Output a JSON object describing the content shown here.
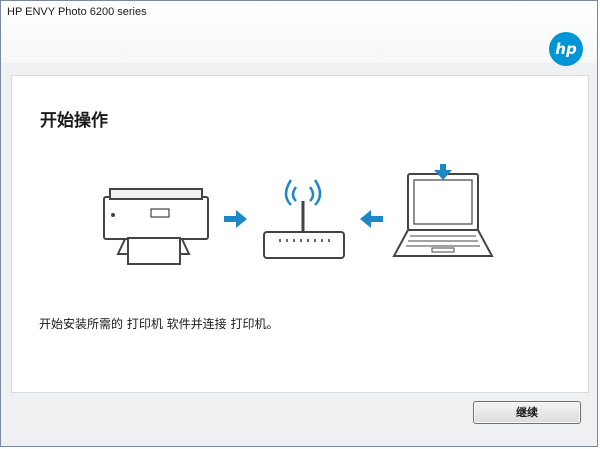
{
  "window": {
    "title": "HP ENVY Photo 6200 series"
  },
  "brand": {
    "logo_text": "hp",
    "logo_color": "#0096d6"
  },
  "page": {
    "heading": "开始操作",
    "description": "开始安装所需的 打印机 软件并连接 打印机。"
  },
  "illustration": {
    "items": [
      "printer-icon",
      "right-arrow-icon",
      "wifi-router-icon",
      "left-arrow-icon",
      "laptop-icon",
      "download-arrow-icon"
    ],
    "accent_color": "#1e88c7"
  },
  "buttons": {
    "continue_label": "继续"
  }
}
